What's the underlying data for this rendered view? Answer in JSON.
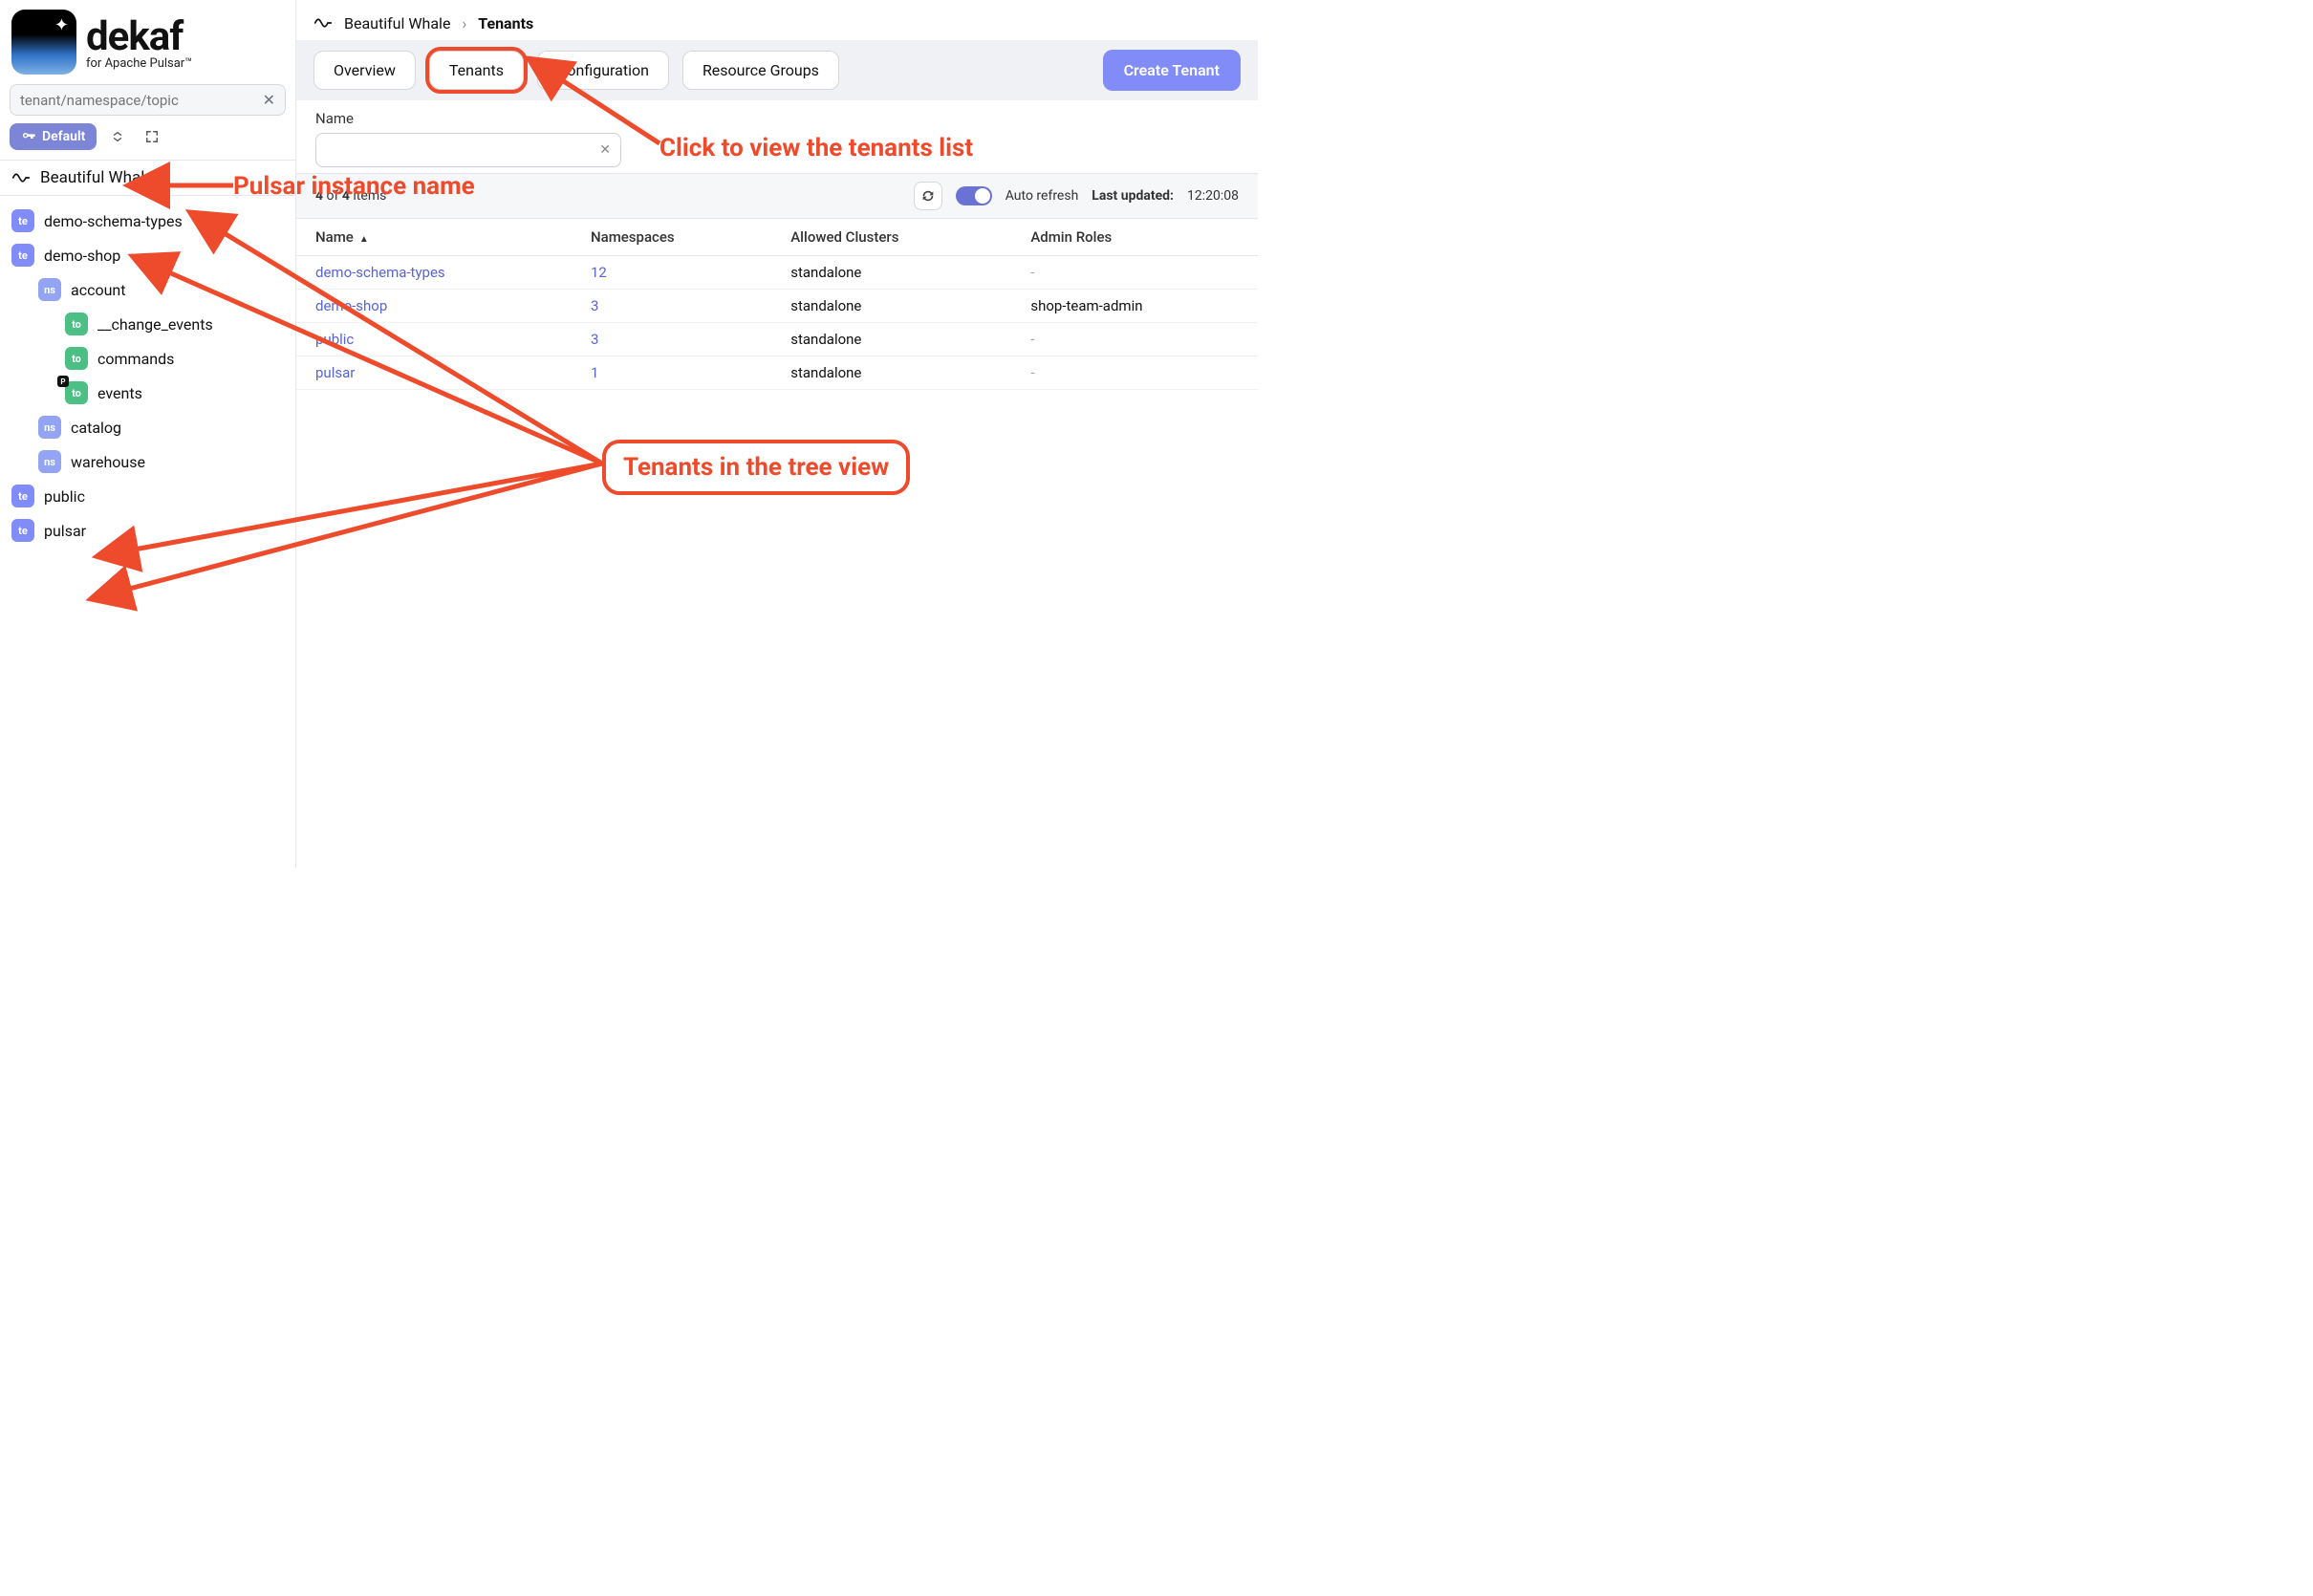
{
  "brand": {
    "title": "dekaf",
    "subtitle": "for Apache Pulsar™"
  },
  "sidebar": {
    "search_placeholder": "tenant/namespace/topic",
    "default_chip": "Default",
    "instance_name": "Beautiful Whale",
    "tree": [
      {
        "type": "te",
        "label": "demo-schema-types",
        "indent": 0
      },
      {
        "type": "te",
        "label": "demo-shop",
        "indent": 0
      },
      {
        "type": "ns",
        "label": "account",
        "indent": 1
      },
      {
        "type": "to",
        "label": "__change_events",
        "indent": 2
      },
      {
        "type": "to",
        "label": "commands",
        "indent": 2
      },
      {
        "type": "to",
        "label": "events",
        "indent": 2,
        "p": true
      },
      {
        "type": "ns",
        "label": "catalog",
        "indent": 1
      },
      {
        "type": "ns",
        "label": "warehouse",
        "indent": 1
      },
      {
        "type": "te",
        "label": "public",
        "indent": 0
      },
      {
        "type": "te",
        "label": "pulsar",
        "indent": 0
      }
    ]
  },
  "breadcrumb": {
    "root": "Beautiful Whale",
    "current": "Tenants"
  },
  "tabs": {
    "overview": "Overview",
    "tenants": "Tenants",
    "configuration": "Configuration",
    "resource_groups": "Resource Groups"
  },
  "actions": {
    "create_tenant": "Create Tenant"
  },
  "filter": {
    "label": "Name"
  },
  "status": {
    "count_a": "4",
    "count_of": "of",
    "count_b": "4",
    "count_items": "items",
    "auto_refresh": "Auto refresh",
    "last_updated_label": "Last updated:",
    "last_updated_value": "12:20:08"
  },
  "table": {
    "headers": {
      "name": "Name",
      "namespaces": "Namespaces",
      "clusters": "Allowed Clusters",
      "roles": "Admin Roles"
    },
    "rows": [
      {
        "name": "demo-schema-types",
        "namespaces": "12",
        "clusters": "standalone",
        "roles": "-"
      },
      {
        "name": "demo-shop",
        "namespaces": "3",
        "clusters": "standalone",
        "roles": "shop-team-admin"
      },
      {
        "name": "public",
        "namespaces": "3",
        "clusters": "standalone",
        "roles": "-"
      },
      {
        "name": "pulsar",
        "namespaces": "1",
        "clusters": "standalone",
        "roles": "-"
      }
    ]
  },
  "annotations": {
    "instance": "Pulsar instance name",
    "click": "Click to view the tenants list",
    "tree": "Tenants in the tree view"
  }
}
